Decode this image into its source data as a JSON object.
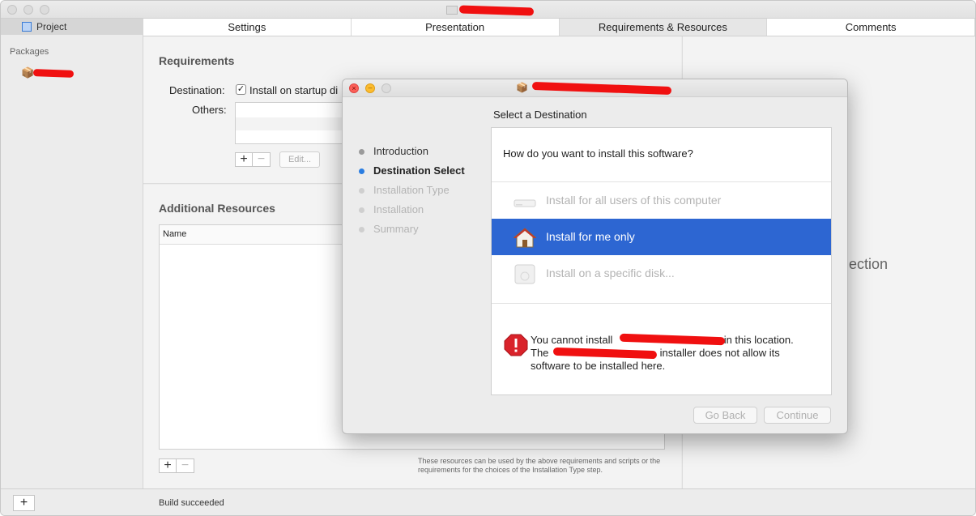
{
  "window": {
    "title": ""
  },
  "sidebar": {
    "project_label": "Project",
    "packages_label": "Packages"
  },
  "tabs": [
    {
      "label": "Settings",
      "active": false
    },
    {
      "label": "Presentation",
      "active": false
    },
    {
      "label": "Requirements & Resources",
      "active": true
    },
    {
      "label": "Comments",
      "active": false
    }
  ],
  "requirements": {
    "title": "Requirements",
    "destination_label": "Destination:",
    "destination_checkbox_label": "Install on startup di",
    "destination_checked": true,
    "others_label": "Others:",
    "edit_label": "Edit..."
  },
  "resources": {
    "title": "Additional Resources",
    "column_name": "Name",
    "note": "These resources can be used by the above requirements and scripts or the requirements for the choices of the Installation Type step."
  },
  "right_panel": {
    "text": "ection"
  },
  "bottom": {
    "status": "Build succeeded"
  },
  "installer": {
    "title": "",
    "heading": "Select a Destination",
    "steps": [
      {
        "label": "Introduction",
        "state": "done"
      },
      {
        "label": "Destination Select",
        "state": "current"
      },
      {
        "label": "Installation Type",
        "state": "pending"
      },
      {
        "label": "Installation",
        "state": "pending"
      },
      {
        "label": "Summary",
        "state": "pending"
      }
    ],
    "question": "How do you want to install this software?",
    "options": [
      {
        "label": "Install for all users of this computer",
        "state": "disabled",
        "icon": "drive-icon"
      },
      {
        "label": "Install for me only",
        "state": "selected",
        "icon": "home-icon"
      },
      {
        "label": "Install on a specific disk...",
        "state": "disabled",
        "icon": "disk-icon"
      }
    ],
    "warning_line1": "You cannot install",
    "warning_line1_end": "in this location.",
    "warning_line2_start": "The",
    "warning_line2_end": "installer does not allow its",
    "warning_line3": "software to be installed here.",
    "go_back_label": "Go Back",
    "continue_label": "Continue"
  },
  "colors": {
    "accent": "#2d66d2",
    "step_current": "#2a7de1",
    "warning": "#d9222a"
  }
}
